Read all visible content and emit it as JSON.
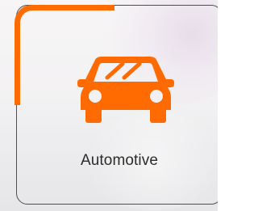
{
  "card": {
    "label": "Automotive",
    "icon": "car-icon",
    "accent_color": "#ff6b00",
    "border_color": "#4f4f52"
  }
}
